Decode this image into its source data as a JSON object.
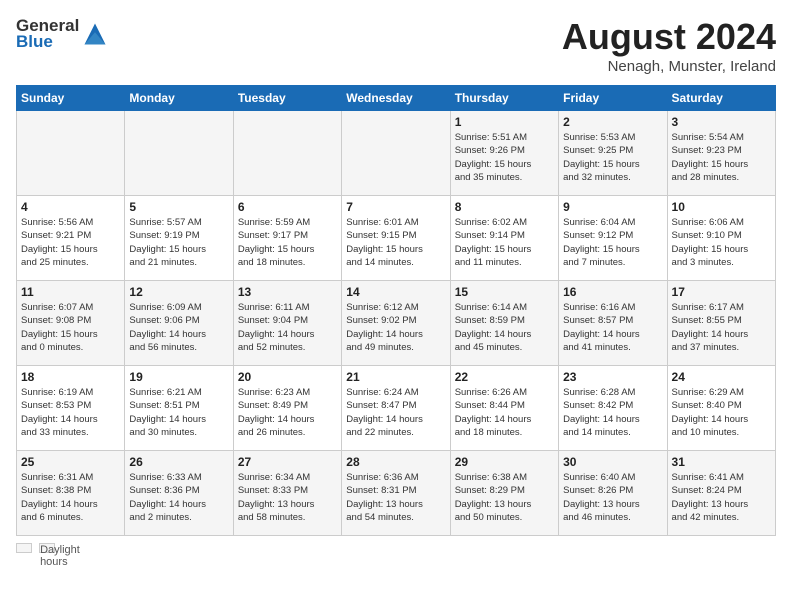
{
  "header": {
    "logo_line1": "General",
    "logo_line2": "Blue",
    "title": "August 2024",
    "subtitle": "Nenagh, Munster, Ireland"
  },
  "days_of_week": [
    "Sunday",
    "Monday",
    "Tuesday",
    "Wednesday",
    "Thursday",
    "Friday",
    "Saturday"
  ],
  "footer": {
    "label": "Daylight hours"
  },
  "weeks": [
    [
      {
        "day": "",
        "info": ""
      },
      {
        "day": "",
        "info": ""
      },
      {
        "day": "",
        "info": ""
      },
      {
        "day": "",
        "info": ""
      },
      {
        "day": "1",
        "info": "Sunrise: 5:51 AM\nSunset: 9:26 PM\nDaylight: 15 hours\nand 35 minutes."
      },
      {
        "day": "2",
        "info": "Sunrise: 5:53 AM\nSunset: 9:25 PM\nDaylight: 15 hours\nand 32 minutes."
      },
      {
        "day": "3",
        "info": "Sunrise: 5:54 AM\nSunset: 9:23 PM\nDaylight: 15 hours\nand 28 minutes."
      }
    ],
    [
      {
        "day": "4",
        "info": "Sunrise: 5:56 AM\nSunset: 9:21 PM\nDaylight: 15 hours\nand 25 minutes."
      },
      {
        "day": "5",
        "info": "Sunrise: 5:57 AM\nSunset: 9:19 PM\nDaylight: 15 hours\nand 21 minutes."
      },
      {
        "day": "6",
        "info": "Sunrise: 5:59 AM\nSunset: 9:17 PM\nDaylight: 15 hours\nand 18 minutes."
      },
      {
        "day": "7",
        "info": "Sunrise: 6:01 AM\nSunset: 9:15 PM\nDaylight: 15 hours\nand 14 minutes."
      },
      {
        "day": "8",
        "info": "Sunrise: 6:02 AM\nSunset: 9:14 PM\nDaylight: 15 hours\nand 11 minutes."
      },
      {
        "day": "9",
        "info": "Sunrise: 6:04 AM\nSunset: 9:12 PM\nDaylight: 15 hours\nand 7 minutes."
      },
      {
        "day": "10",
        "info": "Sunrise: 6:06 AM\nSunset: 9:10 PM\nDaylight: 15 hours\nand 3 minutes."
      }
    ],
    [
      {
        "day": "11",
        "info": "Sunrise: 6:07 AM\nSunset: 9:08 PM\nDaylight: 15 hours\nand 0 minutes."
      },
      {
        "day": "12",
        "info": "Sunrise: 6:09 AM\nSunset: 9:06 PM\nDaylight: 14 hours\nand 56 minutes."
      },
      {
        "day": "13",
        "info": "Sunrise: 6:11 AM\nSunset: 9:04 PM\nDaylight: 14 hours\nand 52 minutes."
      },
      {
        "day": "14",
        "info": "Sunrise: 6:12 AM\nSunset: 9:02 PM\nDaylight: 14 hours\nand 49 minutes."
      },
      {
        "day": "15",
        "info": "Sunrise: 6:14 AM\nSunset: 8:59 PM\nDaylight: 14 hours\nand 45 minutes."
      },
      {
        "day": "16",
        "info": "Sunrise: 6:16 AM\nSunset: 8:57 PM\nDaylight: 14 hours\nand 41 minutes."
      },
      {
        "day": "17",
        "info": "Sunrise: 6:17 AM\nSunset: 8:55 PM\nDaylight: 14 hours\nand 37 minutes."
      }
    ],
    [
      {
        "day": "18",
        "info": "Sunrise: 6:19 AM\nSunset: 8:53 PM\nDaylight: 14 hours\nand 33 minutes."
      },
      {
        "day": "19",
        "info": "Sunrise: 6:21 AM\nSunset: 8:51 PM\nDaylight: 14 hours\nand 30 minutes."
      },
      {
        "day": "20",
        "info": "Sunrise: 6:23 AM\nSunset: 8:49 PM\nDaylight: 14 hours\nand 26 minutes."
      },
      {
        "day": "21",
        "info": "Sunrise: 6:24 AM\nSunset: 8:47 PM\nDaylight: 14 hours\nand 22 minutes."
      },
      {
        "day": "22",
        "info": "Sunrise: 6:26 AM\nSunset: 8:44 PM\nDaylight: 14 hours\nand 18 minutes."
      },
      {
        "day": "23",
        "info": "Sunrise: 6:28 AM\nSunset: 8:42 PM\nDaylight: 14 hours\nand 14 minutes."
      },
      {
        "day": "24",
        "info": "Sunrise: 6:29 AM\nSunset: 8:40 PM\nDaylight: 14 hours\nand 10 minutes."
      }
    ],
    [
      {
        "day": "25",
        "info": "Sunrise: 6:31 AM\nSunset: 8:38 PM\nDaylight: 14 hours\nand 6 minutes."
      },
      {
        "day": "26",
        "info": "Sunrise: 6:33 AM\nSunset: 8:36 PM\nDaylight: 14 hours\nand 2 minutes."
      },
      {
        "day": "27",
        "info": "Sunrise: 6:34 AM\nSunset: 8:33 PM\nDaylight: 13 hours\nand 58 minutes."
      },
      {
        "day": "28",
        "info": "Sunrise: 6:36 AM\nSunset: 8:31 PM\nDaylight: 13 hours\nand 54 minutes."
      },
      {
        "day": "29",
        "info": "Sunrise: 6:38 AM\nSunset: 8:29 PM\nDaylight: 13 hours\nand 50 minutes."
      },
      {
        "day": "30",
        "info": "Sunrise: 6:40 AM\nSunset: 8:26 PM\nDaylight: 13 hours\nand 46 minutes."
      },
      {
        "day": "31",
        "info": "Sunrise: 6:41 AM\nSunset: 8:24 PM\nDaylight: 13 hours\nand 42 minutes."
      }
    ]
  ]
}
